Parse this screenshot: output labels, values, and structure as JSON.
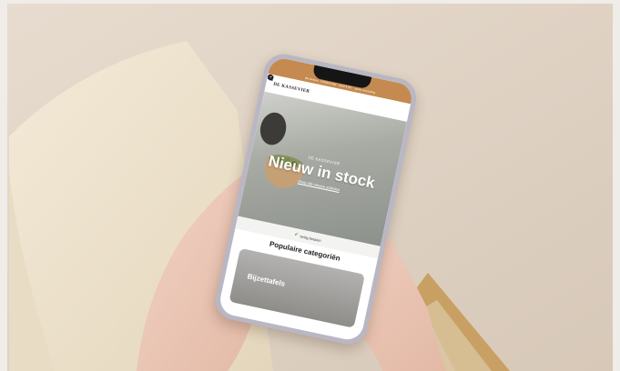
{
  "phone_screen": {
    "promo_bar": "We leveren · thuisbezorgd · vanaf € 50,- · gratis verzending",
    "logo": "DE KASSEVIER",
    "icons": [
      "search-icon",
      "cart-icon",
      "account-icon",
      "menu-icon"
    ],
    "hero": {
      "subtitle_top": "DE KASSEVIER",
      "title": "Nieuw in stock",
      "link": "Shop alle nieuwe artikelen"
    },
    "usp": "Veilig betalen",
    "categories_title": "Populaire categoriën",
    "category_card": "Bijzettafels"
  },
  "colors": {
    "promo_bar": "#c48a4f",
    "background": "#e2d6c9",
    "cushion": "#efe4cf"
  }
}
